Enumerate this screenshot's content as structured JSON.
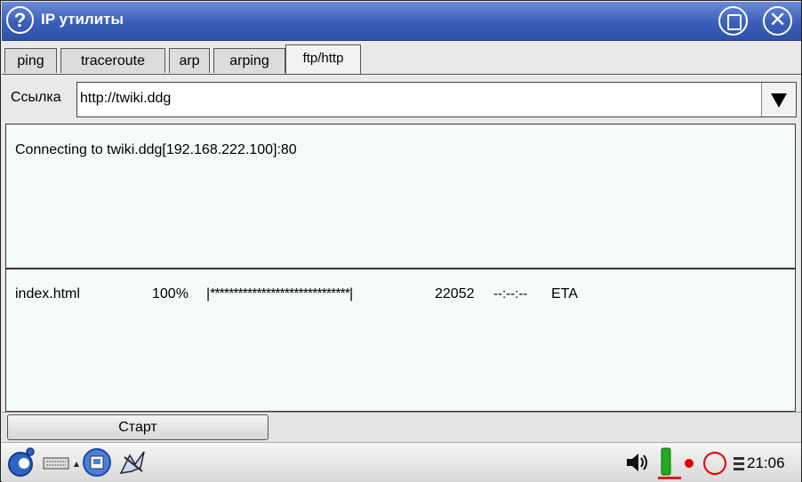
{
  "window": {
    "title": "IP утилиты"
  },
  "tabs": [
    {
      "label": "ping"
    },
    {
      "label": "traceroute"
    },
    {
      "label": "arp"
    },
    {
      "label": "arping"
    },
    {
      "label": "ftp/http"
    }
  ],
  "link": {
    "label": "Ссылка",
    "value": "http://twiki.ddg"
  },
  "output": {
    "connect_line": "Connecting to twiki.ddg[192.168.222.100]:80"
  },
  "download": {
    "filename": "index.html",
    "percent": "100%",
    "bar_open": "|",
    "bar_stars": "******************************",
    "bar_close": "|",
    "bytes": "22052",
    "eta_time": "--:--:--",
    "eta_label": "ETA"
  },
  "controls": {
    "start_label": "Старт"
  },
  "taskbar": {
    "clock": "21:06"
  },
  "colors": {
    "titlebar": "#3b5fb9",
    "panel_bg": "#f4fbf8",
    "battery": "#22aa22",
    "record_dot": "#e00000",
    "ring": "#e00000"
  },
  "icons": [
    "help-icon",
    "maximize-icon",
    "close-icon",
    "menu-icon",
    "keyboard-icon",
    "arrow-up-icon",
    "app-icon",
    "tool-icon",
    "speaker-icon",
    "battery-icon",
    "record-dot-icon",
    "circle-icon",
    "network-icon"
  ]
}
